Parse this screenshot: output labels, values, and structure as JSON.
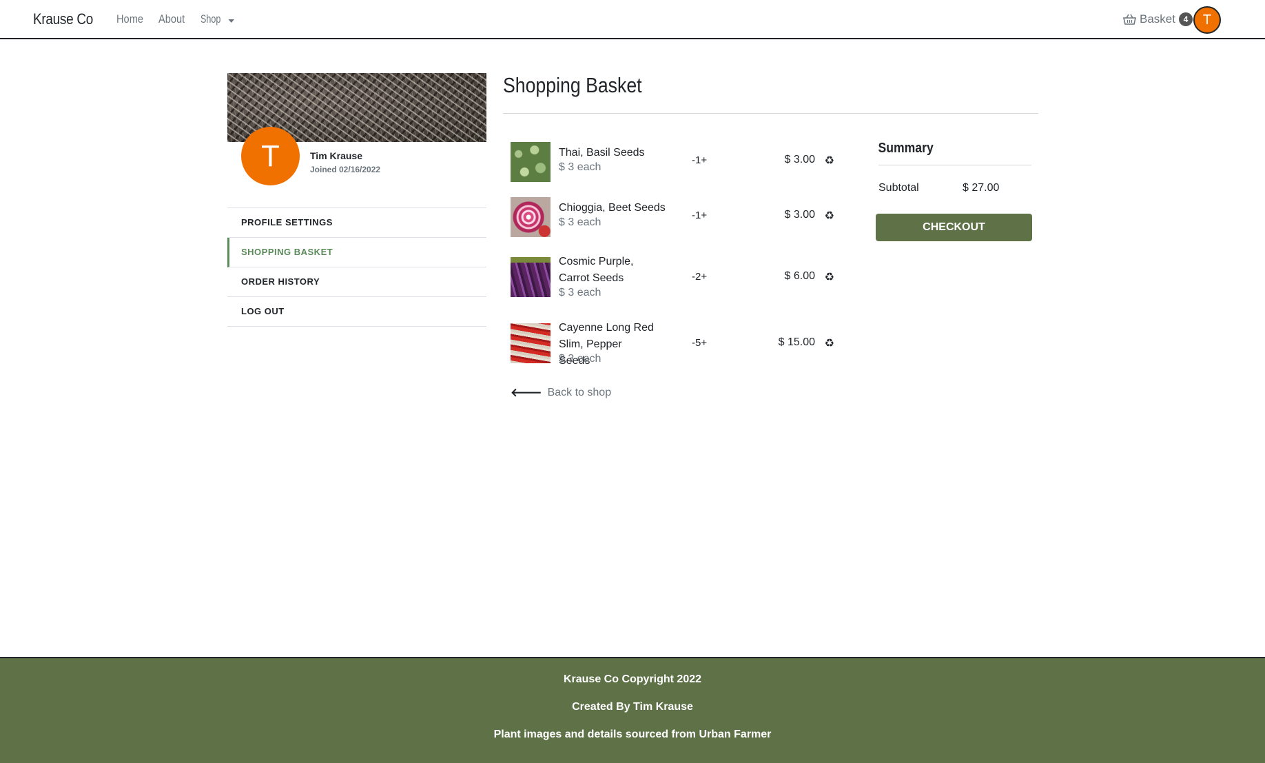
{
  "navbar": {
    "brand": "Krause Co",
    "links": [
      "Home",
      "About",
      "Shop"
    ],
    "basket_label": "Basket",
    "basket_count": "4",
    "avatar_initial": "T"
  },
  "profile": {
    "initial": "T",
    "name": "Tim Krause",
    "joined": "Joined 02/16/2022"
  },
  "side_menu": [
    "PROFILE SETTINGS",
    "SHOPPING BASKET",
    "ORDER HISTORY",
    "LOG OUT"
  ],
  "page_title": "Shopping Basket",
  "basket_items": [
    {
      "name": "Thai, Basil Seeds",
      "each": "$ 3 each",
      "qty": "-1+",
      "price": "$ 3.00"
    },
    {
      "name": "Chioggia, Beet Seeds",
      "each": "$ 3 each",
      "qty": "-1+",
      "price": "$ 3.00"
    },
    {
      "name": "Cosmic Purple, Carrot Seeds",
      "each": "$ 3 each",
      "qty": "-2+",
      "price": "$ 6.00"
    },
    {
      "name": "Cayenne Long Red Slim, Pepper Seeds",
      "each": "$ 3 each",
      "qty": "-5+",
      "price": "$ 15.00"
    }
  ],
  "remove_icon": "♻",
  "back_link": "Back to shop",
  "summary": {
    "title": "Summary",
    "subtotal_label": "Subtotal",
    "subtotal_value": "$ 27.00",
    "checkout_label": "CHECKOUT"
  },
  "footer": {
    "line1": "Krause Co Copyright 2022",
    "line2": "Created By Tim Krause",
    "line3": "Plant images and details sourced from Urban Farmer"
  },
  "colors": {
    "accent_green": "#5e7147",
    "avatar_orange": "#f07000",
    "active_menu": "#5a8a5a"
  }
}
